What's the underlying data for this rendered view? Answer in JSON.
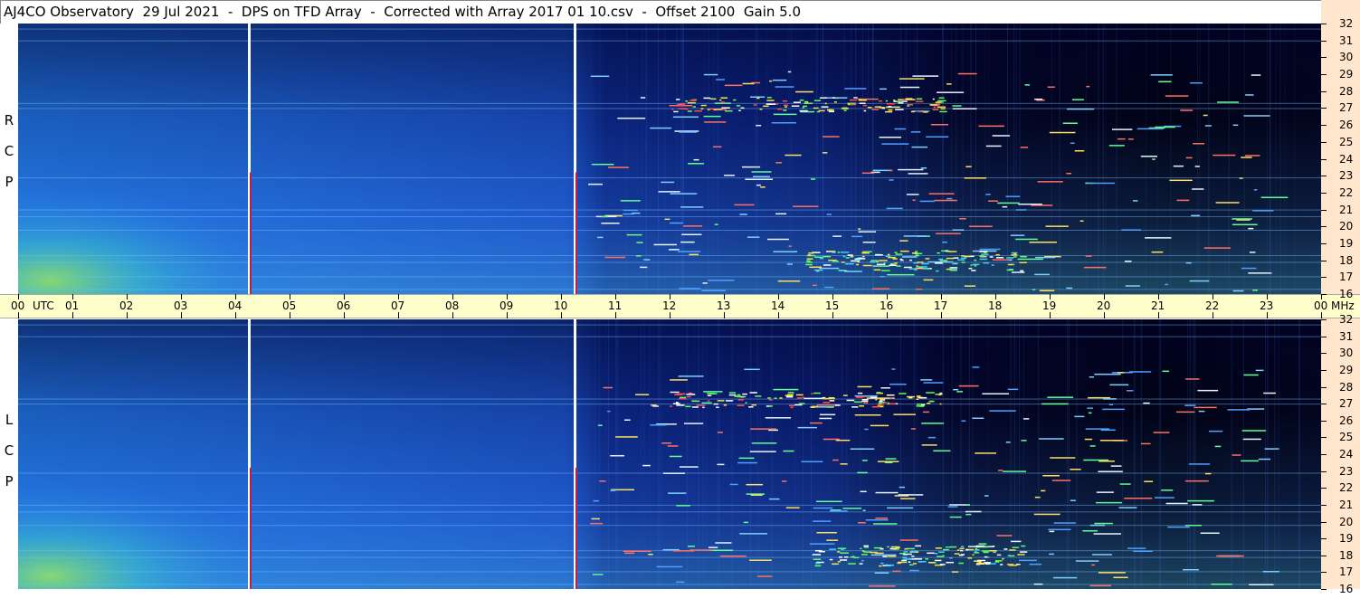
{
  "title": "AJ4CO Observatory  29 Jul 2021  -  DPS on TFD Array  -  Corrected with Array 2017 01 10.csv  -  Offset 2100  Gain 5.0",
  "colors": {
    "axis_time_bg": "#ffffcc",
    "axis_freq_bg": "#ffe6cc",
    "background_low": "#000010",
    "background_mid": "#0a2aa0",
    "background_high": "#2f7fe8"
  },
  "chart_data": {
    "type": "heatmap",
    "x_axis": {
      "ticks": [
        "00",
        "01",
        "02",
        "03",
        "04",
        "05",
        "06",
        "07",
        "08",
        "09",
        "10",
        "11",
        "12",
        "13",
        "14",
        "15",
        "16",
        "17",
        "18",
        "19",
        "20",
        "21",
        "22",
        "23",
        "00"
      ],
      "unit_label": "UTC",
      "range": [
        0,
        24
      ]
    },
    "y_axis": {
      "ticks": [
        "16",
        "17",
        "18",
        "19",
        "20",
        "21",
        "22",
        "23",
        "24",
        "25",
        "26",
        "27",
        "28",
        "29",
        "30",
        "31",
        "32"
      ],
      "unit_label": "MHz",
      "range": [
        16,
        32
      ]
    },
    "panels": [
      {
        "label": "R C P"
      },
      {
        "label": "L C P"
      }
    ],
    "vertical_markers_utc": [
      4.25,
      10.25
    ]
  }
}
